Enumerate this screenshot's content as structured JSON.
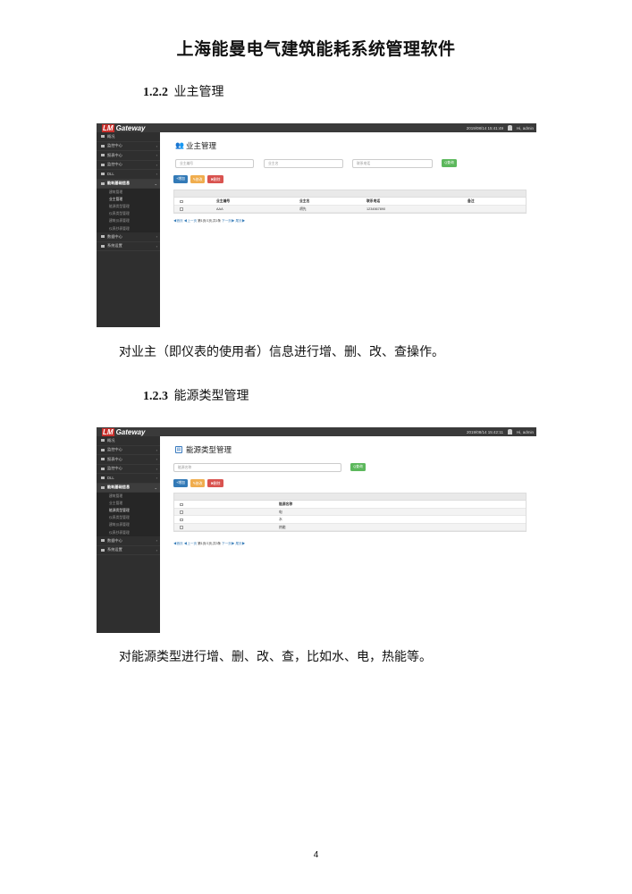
{
  "doc_title": "上海能曼电气建筑能耗系统管理软件",
  "section1": {
    "number": "1.2.2",
    "title": "业主管理",
    "description": "对业主（即仪表的使用者）信息进行增、删、改、查操作。"
  },
  "section2": {
    "number": "1.2.3",
    "title": "能源类型管理",
    "description": "对能源类型进行增、删、改、查，比如水、电，热能等。"
  },
  "page_number": "4",
  "app": {
    "logo_mark": "LM",
    "logo_text": "Gateway",
    "user_label": "Hi, admin"
  },
  "sidebar": {
    "items_top": [
      {
        "label": "概况"
      },
      {
        "label": "监控中心"
      },
      {
        "label": "报表中心"
      },
      {
        "label": "监控中心"
      },
      {
        "label": "DLL"
      }
    ],
    "group_label": "能耗基础信息",
    "sub_items": [
      "建筑管理",
      "业主管理",
      "能源类型管理",
      "仪表类型管理",
      "建筑仪表管理",
      "仪表抄表管理"
    ],
    "items_bottom": [
      {
        "label": "数据中心"
      },
      {
        "label": "系统设置"
      }
    ]
  },
  "screenshot1": {
    "datetime": "2019/08/14  15:41:49",
    "page_title": "业主管理",
    "search_placeholders": [
      "业主编号",
      "业主名",
      "联系电话"
    ],
    "search_button": "Q查询",
    "buttons": {
      "add": "+增加",
      "edit": "✎修改",
      "delete": "✖删除"
    },
    "columns": [
      "业主编号",
      "业主名",
      "联系电话",
      "备注"
    ],
    "rows": [
      {
        "id": "AAA",
        "name": "胡先",
        "phone": "1234567890",
        "note": ""
      }
    ],
    "pager": {
      "first": "◀首页",
      "prev": "◀上一页",
      "info": "第1页/1页,共1条",
      "next": "下一页▶",
      "last": "尾页▶"
    }
  },
  "screenshot2": {
    "datetime": "2019/08/14  15:42:11",
    "page_title": "能源类型管理",
    "search_placeholder": "能源名称",
    "search_button": "Q查询",
    "buttons": {
      "add": "+增加",
      "edit": "✎修改",
      "delete": "✖删除"
    },
    "columns": [
      "能源名称"
    ],
    "rows": [
      {
        "name": "电"
      },
      {
        "name": "水"
      },
      {
        "name": "热能"
      }
    ],
    "pager": {
      "first": "◀首页",
      "prev": "◀上一页",
      "info": "第1页/1页,共3条",
      "next": "下一页▶",
      "last": "尾页▶"
    }
  }
}
